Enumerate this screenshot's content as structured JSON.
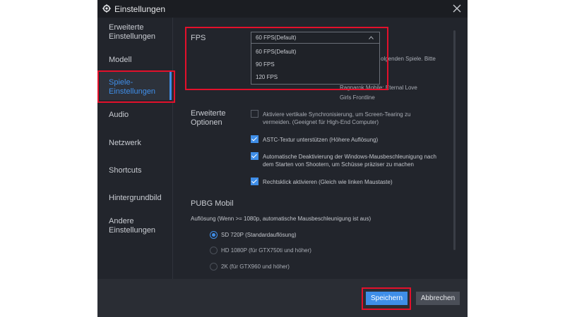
{
  "window": {
    "title": "Einstellungen"
  },
  "sidebar": {
    "items": [
      {
        "label1": "Erweiterte",
        "label2": "Einstellungen"
      },
      {
        "label1": "Modell"
      },
      {
        "label1": "Spiele-",
        "label2": "Einstellungen"
      },
      {
        "label1": "Audio"
      },
      {
        "label1": "Netzwerk"
      },
      {
        "label1": "Shortcuts"
      },
      {
        "label1": "Hintergrundbild"
      },
      {
        "label1": "Andere",
        "label2": "Einstellungen"
      }
    ],
    "active_index": 2
  },
  "fps": {
    "label": "FPS",
    "selected": "60 FPS(Default)",
    "options": [
      "60 FPS(Default)",
      "90 FPS",
      "120 FPS"
    ],
    "hint_partial": "olgenden Spiele. Bitte",
    "games": [
      "Ragnarok Mobile: Eternal Love",
      "Girls Frontline"
    ]
  },
  "advanced": {
    "label1": "Erweiterte",
    "label2": "Optionen",
    "options": [
      {
        "line1": "Aktiviere vertikale Synchronisierung, um Screen-Tearing zu",
        "line2": "vermeiden.  (Geeignet für High-End Computer)",
        "checked": false
      },
      {
        "line1": "ASTC-Textur unterstützen  (Höhere Auflösung)",
        "checked": true
      },
      {
        "line1": "Automatische Deaktivierung der Windows-Mausbeschleunigung nach",
        "line2": "dem Starten von Shootern, um Schüsse präziser zu machen",
        "checked": true
      },
      {
        "line1": "Rechtsklick aktivieren (Gleich wie linken Maustaste)",
        "checked": true
      }
    ]
  },
  "pubg": {
    "label": "PUBG Mobil",
    "resolution_note": "Auflösung (Wenn >= 1080p, automatische Mausbeschleunigung ist aus)",
    "resolutions": [
      {
        "label": "SD 720P   (Standardauflösung)",
        "selected": true
      },
      {
        "label": "HD 1080P   (für GTX750ti und höher)",
        "selected": false
      },
      {
        "label": "2K   (für GTX960 und höher)",
        "selected": false
      }
    ]
  },
  "footer": {
    "save_label": "Speichern",
    "cancel_label": "Abbrechen"
  },
  "colors": {
    "accent": "#3f8ee8",
    "highlight": "#e3102b",
    "window_bg": "#22252c"
  }
}
